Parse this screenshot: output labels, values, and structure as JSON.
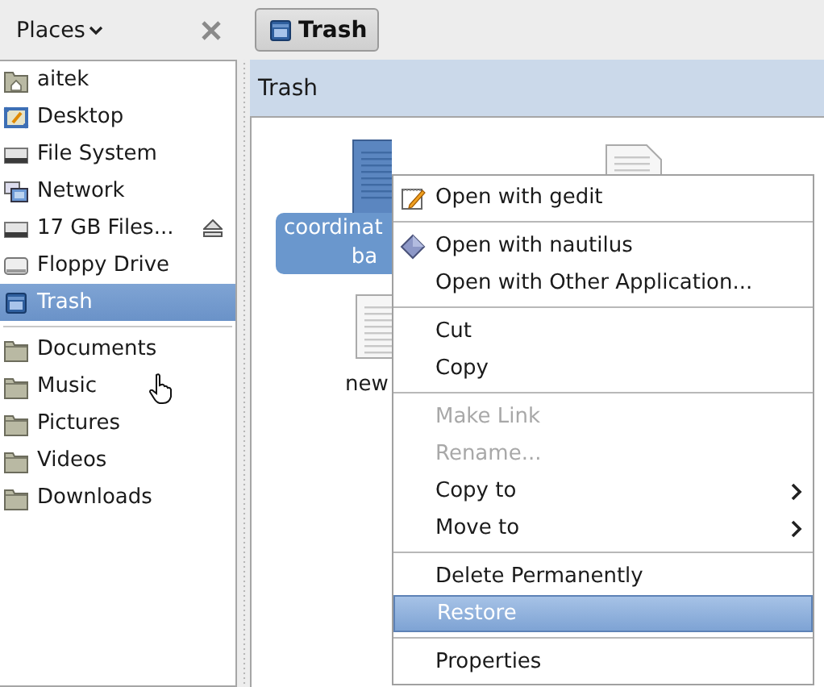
{
  "sidebar": {
    "title": "Places",
    "items": [
      {
        "label": "aitek",
        "kind": "home",
        "selected": false
      },
      {
        "label": "Desktop",
        "kind": "desktop",
        "selected": false
      },
      {
        "label": "File System",
        "kind": "drive",
        "selected": false
      },
      {
        "label": "Network",
        "kind": "network",
        "selected": false
      },
      {
        "label": "17 GB Files...",
        "kind": "drive",
        "selected": false,
        "eject": true
      },
      {
        "label": "Floppy Drive",
        "kind": "floppy",
        "selected": false
      },
      {
        "label": "Trash",
        "kind": "trash",
        "selected": true
      },
      {
        "kind": "separator"
      },
      {
        "label": "Documents",
        "kind": "folder",
        "selected": false
      },
      {
        "label": "Music",
        "kind": "folder",
        "selected": false
      },
      {
        "label": "Pictures",
        "kind": "folder",
        "selected": false
      },
      {
        "label": "Videos",
        "kind": "folder",
        "selected": false
      },
      {
        "label": "Downloads",
        "kind": "folder",
        "selected": false
      }
    ]
  },
  "path_button": {
    "label": "Trash"
  },
  "location_header": "Trash",
  "files": [
    {
      "label": [
        "coordinat",
        "ba"
      ],
      "selected": true
    },
    {
      "selected": false
    },
    {
      "label": [
        "new"
      ],
      "selected": false
    }
  ],
  "context_menu": [
    {
      "kind": "gedit",
      "label": "Open with gedit",
      "disabled": false,
      "submenu": false,
      "selected": false
    },
    {
      "kind": "separator"
    },
    {
      "kind": "nautilus",
      "label": "Open with nautilus",
      "disabled": false,
      "submenu": false,
      "selected": false
    },
    {
      "kind": "item",
      "label": "Open with Other Application...",
      "disabled": false,
      "submenu": false,
      "selected": false
    },
    {
      "kind": "separator"
    },
    {
      "kind": "item",
      "label": "Cut",
      "disabled": false,
      "submenu": false,
      "selected": false
    },
    {
      "kind": "item",
      "label": "Copy",
      "disabled": false,
      "submenu": false,
      "selected": false
    },
    {
      "kind": "separator"
    },
    {
      "kind": "item",
      "label": "Make Link",
      "disabled": true,
      "submenu": false,
      "selected": false
    },
    {
      "kind": "item",
      "label": "Rename...",
      "disabled": true,
      "submenu": false,
      "selected": false
    },
    {
      "kind": "item",
      "label": "Copy to",
      "disabled": false,
      "submenu": true,
      "selected": false
    },
    {
      "kind": "item",
      "label": "Move to",
      "disabled": false,
      "submenu": true,
      "selected": false
    },
    {
      "kind": "separator"
    },
    {
      "kind": "item",
      "label": "Delete Permanently",
      "disabled": false,
      "submenu": false,
      "selected": false
    },
    {
      "kind": "item",
      "label": "Restore",
      "disabled": false,
      "submenu": false,
      "selected": true
    },
    {
      "kind": "separator"
    },
    {
      "kind": "item",
      "label": "Properties",
      "disabled": false,
      "submenu": false,
      "selected": false
    }
  ]
}
